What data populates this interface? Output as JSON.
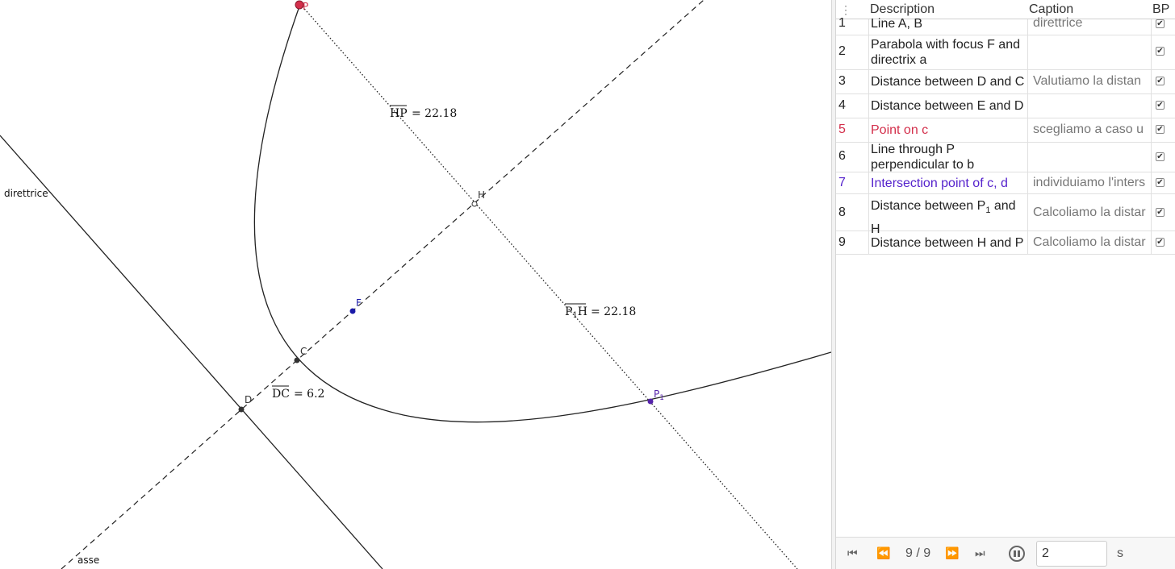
{
  "graphics": {
    "labels": {
      "direttrice": "direttrice",
      "asse": "asse",
      "point_P": "P",
      "point_H": "H",
      "point_F": "F",
      "point_C": "C",
      "point_D": "D",
      "point_P1": "P",
      "point_P1_sub": "1"
    },
    "measures": {
      "hp_name": "HP",
      "hp_value": "= 22.18",
      "p1h_name_a": "P",
      "p1h_sub": "1",
      "p1h_name_b": "H",
      "p1h_value": "= 22.18",
      "dc_name": "DC",
      "dc_value": "= 6.2"
    },
    "colors": {
      "point_P": "#d32f4b",
      "point_F": "#1a1aa8",
      "point_P1": "#5522aa",
      "point_dark": "#333333"
    }
  },
  "construction_protocol": {
    "header": {
      "menu_icon": "vertical-dots-icon",
      "description": "Description",
      "caption": "Caption",
      "bp": "BP"
    },
    "rows": [
      {
        "num": "1",
        "desc": "Line A, B",
        "caption": "direttrice",
        "checked": true,
        "color": "#222222"
      },
      {
        "num": "2",
        "desc": "Parabola with focus F and directrix a",
        "caption": "",
        "checked": true,
        "color": "#222222"
      },
      {
        "num": "3",
        "desc": "Distance between D and C",
        "caption": "Valutiamo la distan",
        "checked": true,
        "color": "#222222"
      },
      {
        "num": "4",
        "desc": "Distance between E and D",
        "caption": "",
        "checked": true,
        "color": "#222222"
      },
      {
        "num": "5",
        "desc": "Point on c",
        "caption": "scegliamo a caso u",
        "checked": true,
        "color": "#d32f4b"
      },
      {
        "num": "6",
        "desc": "Line through P perpendicular to b",
        "caption": "",
        "checked": true,
        "color": "#222222"
      },
      {
        "num": "7",
        "desc": "Intersection point of c, d",
        "caption": "individuiamo l'inters",
        "checked": true,
        "color": "#5522cc"
      },
      {
        "num": "8",
        "desc_a": "Distance between P",
        "desc_sub": "1",
        "desc_b": " and H",
        "caption": "Calcoliamo la distar",
        "checked": true,
        "color": "#222222"
      },
      {
        "num": "9",
        "desc": "Distance between H and P",
        "caption": "Calcoliamo la distar",
        "checked": true,
        "color": "#222222"
      }
    ],
    "footer": {
      "position": "9 / 9",
      "speed_value": "2",
      "speed_unit": "s",
      "icons": [
        "skip-first-icon",
        "step-back-icon",
        "step-forward-icon",
        "skip-last-icon",
        "pause-icon"
      ]
    }
  }
}
